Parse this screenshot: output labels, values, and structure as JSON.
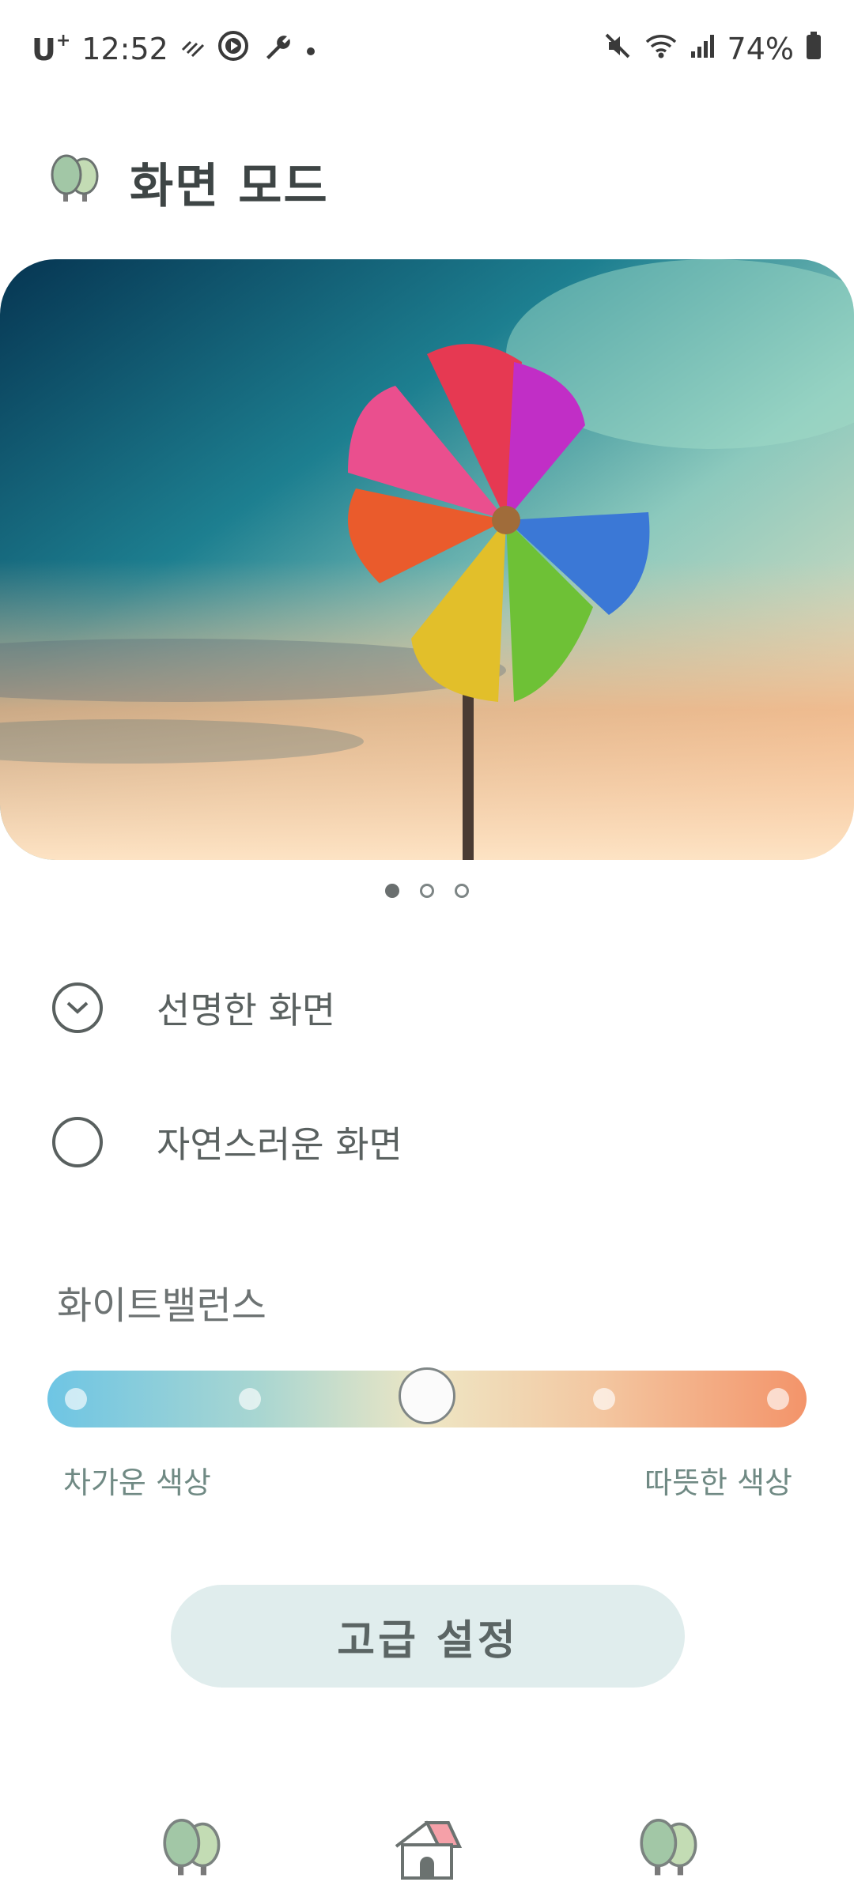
{
  "status_bar": {
    "carrier": "U",
    "carrier_sup": "+",
    "time": "12:52",
    "battery": "74%"
  },
  "header": {
    "title": "화면 모드",
    "icon": "trees-icon"
  },
  "hero": {
    "image": "pinwheel-photo",
    "pager_count": 3,
    "pager_active": 0
  },
  "modes": {
    "options": [
      {
        "label": "선명한 화면",
        "selected": true
      },
      {
        "label": "자연스러운 화면",
        "selected": false
      }
    ]
  },
  "white_balance": {
    "title": "화이트밸런스",
    "cold_label": "차가운 색상",
    "warm_label": "따뜻한 색상",
    "steps": 5,
    "value_step": 2,
    "gradient_colors": [
      "#6ec5e4",
      "#a9d6d1",
      "#eee6c4",
      "#f3c8a2",
      "#f3946a"
    ]
  },
  "advanced_button": {
    "label": "고급 설정"
  },
  "bottom_nav": {
    "items": [
      "trees-icon",
      "home-icon",
      "trees-icon"
    ]
  },
  "colors": {
    "accent_bg": "#e0eded",
    "text": "#3e4545",
    "tree_green": "#a8c8a8",
    "roof_pink": "#f5a0a8"
  }
}
